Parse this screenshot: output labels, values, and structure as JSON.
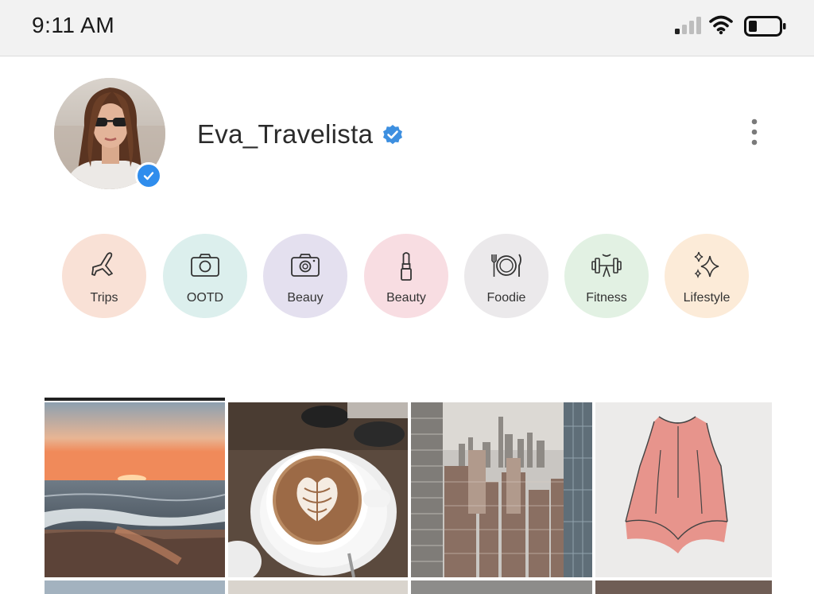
{
  "status_bar": {
    "time": "9:11 AM"
  },
  "profile": {
    "username": "Eva_Travelista",
    "verified_badge_color": "#2f8ded"
  },
  "highlights": [
    {
      "label": "Trips",
      "icon": "airplane-icon",
      "bg": "#f9e1d6"
    },
    {
      "label": "OOTD",
      "icon": "camera-icon",
      "bg": "#dcefed"
    },
    {
      "label": "Beauy",
      "icon": "camera-icon",
      "bg": "#e4e0ef"
    },
    {
      "label": "Beauty",
      "icon": "lipstick-icon",
      "bg": "#f8dde2"
    },
    {
      "label": "Foodie",
      "icon": "plate-cutlery-icon",
      "bg": "#ebe9eb"
    },
    {
      "label": "Fitness",
      "icon": "dumbbell-icon",
      "bg": "#e2f1e3"
    },
    {
      "label": "Lifestyle",
      "icon": "sparkles-icon",
      "bg": "#fcebd8"
    }
  ],
  "grid": {
    "posts": [
      {
        "subject": "sunset-beach"
      },
      {
        "subject": "latte-art"
      },
      {
        "subject": "city-skyline"
      },
      {
        "subject": "pink-top"
      }
    ]
  }
}
